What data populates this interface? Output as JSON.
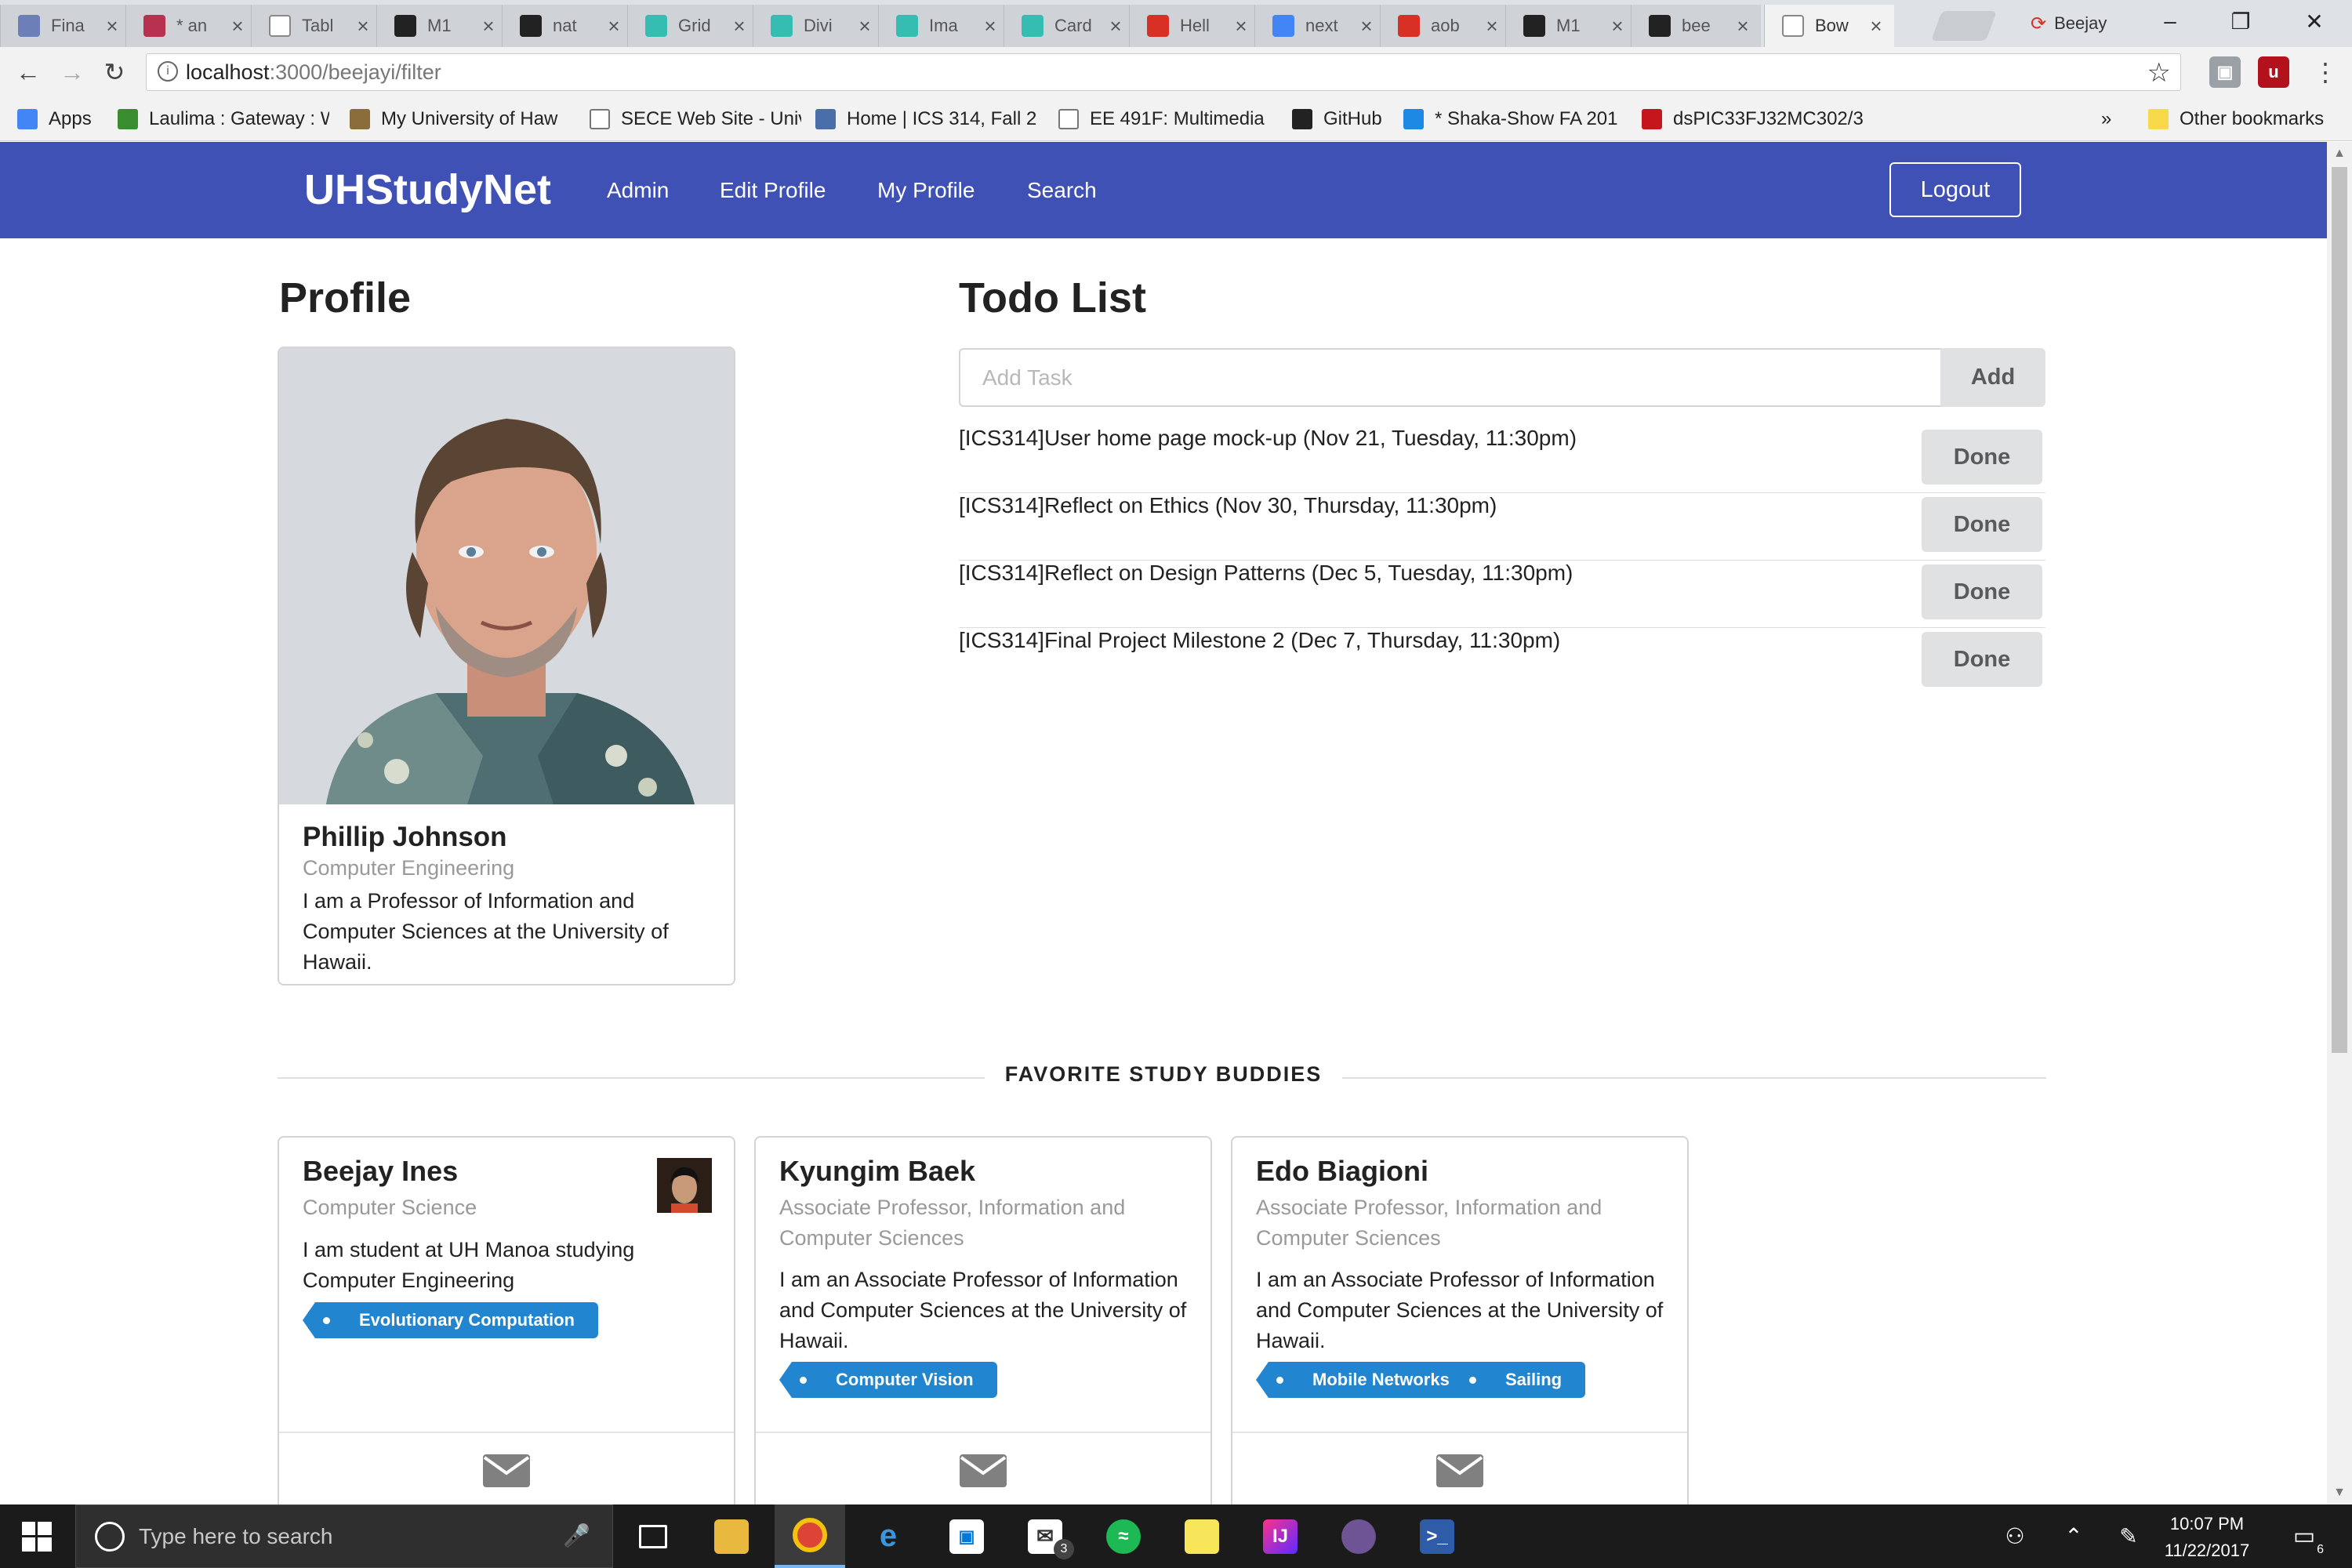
{
  "browser": {
    "tabs": [
      {
        "title": "Fina",
        "icon": "doc-icon",
        "color": "#6c7fb8"
      },
      {
        "title": "* an",
        "icon": "slack-icon",
        "color": "#b7324f"
      },
      {
        "title": "Tabl",
        "icon": "page-icon",
        "color": "#ffffff"
      },
      {
        "title": "M1",
        "icon": "github-icon",
        "color": "#222222"
      },
      {
        "title": "nat",
        "icon": "github-icon",
        "color": "#222222"
      },
      {
        "title": "Grid",
        "icon": "semantic-icon",
        "color": "#35bdb2"
      },
      {
        "title": "Divi",
        "icon": "semantic-icon",
        "color": "#35bdb2"
      },
      {
        "title": "Ima",
        "icon": "semantic-icon",
        "color": "#35bdb2"
      },
      {
        "title": "Card",
        "icon": "semantic-icon",
        "color": "#35bdb2"
      },
      {
        "title": "Hell",
        "icon": "gmail-icon",
        "color": "#d93025"
      },
      {
        "title": "next",
        "icon": "google-icon",
        "color": "#4285f4"
      },
      {
        "title": "aob",
        "icon": "gmail-icon",
        "color": "#d93025"
      },
      {
        "title": "M1",
        "icon": "github-icon",
        "color": "#222222"
      },
      {
        "title": "bee",
        "icon": "github-icon",
        "color": "#222222"
      },
      {
        "title": "Bow",
        "icon": "page-icon",
        "color": "#ffffff",
        "active": true
      }
    ],
    "profile_name": "Beejay",
    "url_host": "localhost",
    "url_path": ":3000/beejayi/filter",
    "bookmarks": [
      {
        "label": "Apps",
        "icon": "apps-icon"
      },
      {
        "label": "Laulima : Gateway : W",
        "icon": "laulima-icon"
      },
      {
        "label": "My University of Haw",
        "icon": "uh-icon"
      },
      {
        "label": "SECE Web Site - Univ",
        "icon": "page-icon"
      },
      {
        "label": "Home | ICS 314, Fall 2",
        "icon": "ics-icon"
      },
      {
        "label": "EE 491F: Multimedia I",
        "icon": "page-icon"
      },
      {
        "label": "GitHub",
        "icon": "github-icon"
      },
      {
        "label": "* Shaka-Show FA 201",
        "icon": "trello-icon"
      },
      {
        "label": "dsPIC33FJ32MC302/3",
        "icon": "microchip-icon"
      }
    ],
    "bookmarks_overflow": "»",
    "other_bookmarks": "Other bookmarks"
  },
  "nav": {
    "brand": "UHStudyNet",
    "links": [
      "Admin",
      "Edit Profile",
      "My Profile",
      "Search"
    ],
    "logout": "Logout"
  },
  "profile": {
    "heading": "Profile",
    "name": "Phillip Johnson",
    "meta": "Computer Engineering",
    "description": "I am a Professor of Information and Computer Sciences at the University of Hawaii."
  },
  "todo": {
    "heading": "Todo List",
    "placeholder": "Add Task",
    "add_label": "Add",
    "done_label": "Done",
    "items": [
      "[ICS314]User home page mock-up (Nov 21, Tuesday, 11:30pm)",
      "[ICS314]Reflect on Ethics (Nov 30, Thursday, 11:30pm)",
      "[ICS314]Reflect on Design Patterns (Dec 5, Tuesday, 11:30pm)",
      "[ICS314]Final Project Milestone 2 (Dec 7, Thursday, 11:30pm)"
    ]
  },
  "buddies": {
    "heading": "FAVORITE STUDY BUDDIES",
    "cards": [
      {
        "name": "Beejay Ines",
        "meta": "Computer Science",
        "description": "I am student at UH Manoa studying Computer Engineering",
        "tags": [
          "Evolutionary Computation"
        ],
        "has_avatar": true
      },
      {
        "name": "Kyungim Baek",
        "meta": "Associate Professor, Information and Computer Sciences",
        "description": "I am an Associate Professor of Information and Computer Sciences at the University of Hawaii.",
        "tags": [
          "Computer Vision"
        ],
        "has_avatar": false
      },
      {
        "name": "Edo Biagioni",
        "meta": "Associate Professor, Information and Computer Sciences",
        "description": "I am an Associate Professor of Information and Computer Sciences at the University of Hawaii.",
        "tags": [
          "Mobile Networks",
          "Sailing"
        ],
        "has_avatar": false
      }
    ]
  },
  "taskbar": {
    "search_placeholder": "Type here to search",
    "mail_badge": "3",
    "time": "10:07 PM",
    "date": "11/22/2017",
    "notification_count": "6"
  },
  "colors": {
    "navbar": "#3f51b5",
    "tag": "#2185d0",
    "button": "#e0e1e2"
  }
}
